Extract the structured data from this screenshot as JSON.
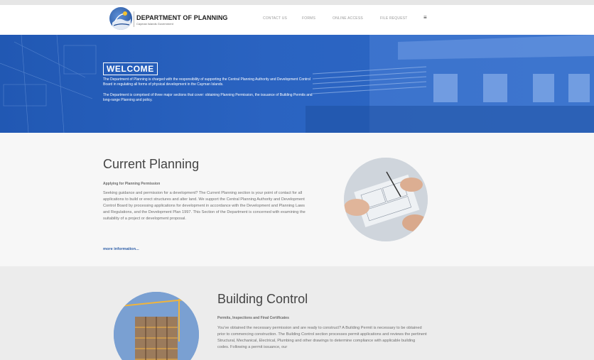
{
  "header": {
    "brand_title": "DEPARTMENT OF PLANNING",
    "brand_subtitle": "Cayman Islands Government",
    "nav": [
      {
        "label": "CONTACT US"
      },
      {
        "label": "FORMS"
      },
      {
        "label": "ONLINE ACCESS"
      },
      {
        "label": "FILE REQUEST"
      }
    ],
    "menu_icon": "≡"
  },
  "hero": {
    "title": "WELCOME",
    "paragraph1": "The Department of Planning is charged with the responsibility of supporting the Central Planning Authority and Development Control Board in regulating all forms of physical development in the Cayman Islands.",
    "paragraph2": "The Department is comprised of three major sections that cover: obtaining Planning Permission, the issuance of Building Permits and long-range Planning and policy."
  },
  "current_planning": {
    "title": "Current Planning",
    "subtitle": "Applying for Planning Permission",
    "body": "Seeking guidance and permission for a development? The Current Planning section is your point of contact for all applications to build or erect structures and alter land. We support the Central Planning Authority and Development Control Board by processing applications for development in accordance with the Development and Planning Laws and Regulations, and the Development Plan 1997. This Section of the Department is concerned with examining the suitability of a project or development proposal.",
    "more_link": "more information..."
  },
  "building_control": {
    "title": "Building Control",
    "subtitle": "Permits, Inspections and Final Certificates",
    "body": "You've obtained the necessary permission and are ready to construct? A Building Permit is necessary to be obtained prior to commencing construction. The Building Control section processes permit applications and reviews the pertinent Structural, Mechanical, Electrical, Plumbing and other drawings to determine compliance with applicable building codes. Following a permit issuance, our"
  },
  "colors": {
    "hero_blue": "#2a63c1",
    "link_blue": "#2f5fa8",
    "section_light": "#f7f7f7",
    "section_gray": "#ececec"
  },
  "icons": [
    "department-logo-icon",
    "hamburger-menu-icon"
  ]
}
